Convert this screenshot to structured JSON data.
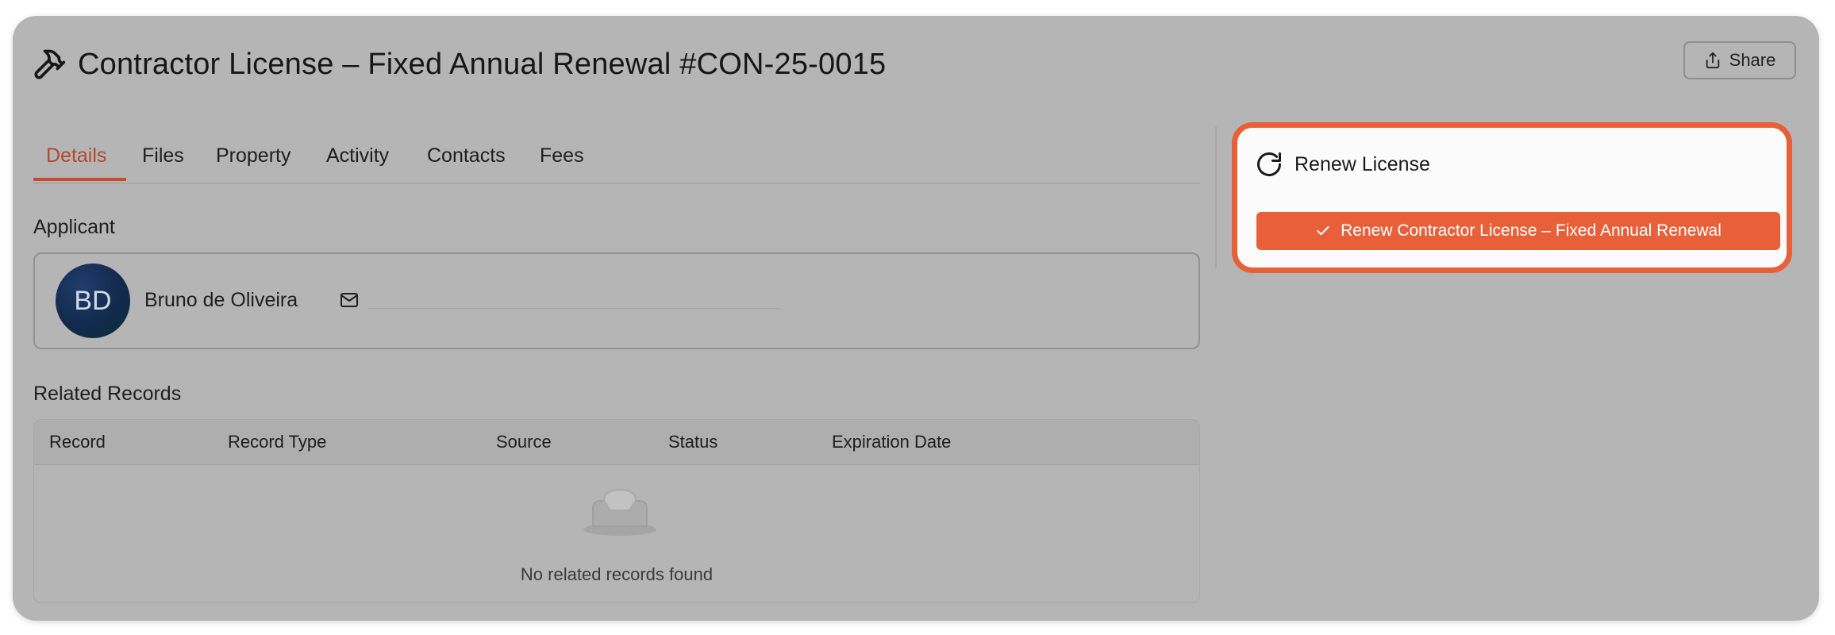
{
  "header": {
    "title": "Contractor License – Fixed Annual Renewal #CON-25-0015",
    "icon": "hammer-icon",
    "share_label": "Share"
  },
  "tabs": [
    {
      "label": "Details",
      "active": true
    },
    {
      "label": "Files"
    },
    {
      "label": "Property"
    },
    {
      "label": "Activity"
    },
    {
      "label": "Contacts"
    },
    {
      "label": "Fees"
    }
  ],
  "applicant": {
    "section_label": "Applicant",
    "initials": "BD",
    "name": "Bruno de Oliveira",
    "email_icon": "mail-icon"
  },
  "related_records": {
    "section_label": "Related Records",
    "columns": [
      "Record",
      "Record Type",
      "Source",
      "Status",
      "Expiration Date"
    ],
    "empty_text": "No related records found"
  },
  "renew": {
    "title": "Renew License",
    "button_label": "Renew Contractor License – Fixed Annual Renewal"
  },
  "colors": {
    "accent": "#e8603a",
    "active_tab": "#b4482b",
    "overlay": "#b5b5b5"
  }
}
